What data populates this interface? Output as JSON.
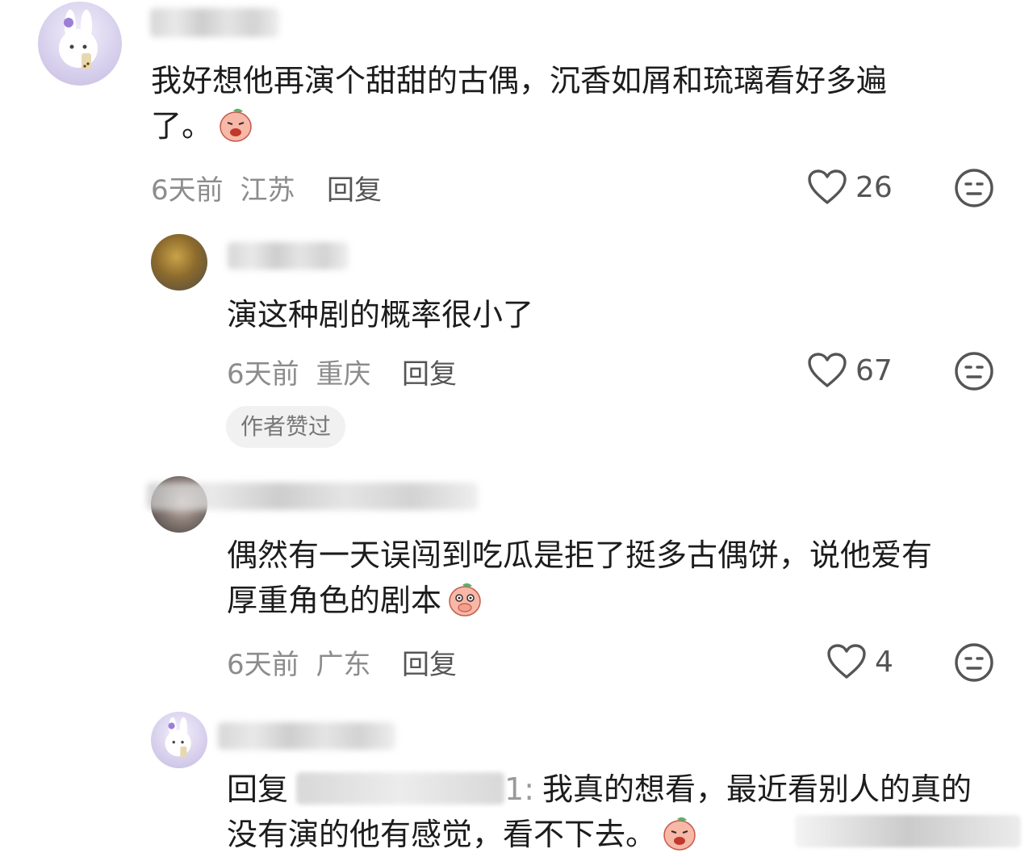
{
  "comments": [
    {
      "text_lines": [
        "我好想他再演个甜甜的古偶，沉香如屑和琉璃看好多遍",
        "了。"
      ],
      "time": "6天前",
      "location": "江苏",
      "reply_label": "回复",
      "likes": "26"
    },
    {
      "text_lines": [
        "演这种剧的概率很小了"
      ],
      "time": "6天前",
      "location": "重庆",
      "reply_label": "回复",
      "likes": "67",
      "badge": "作者赞过"
    },
    {
      "text_lines": [
        "偶然有一天误闯到吃瓜是拒了挺多古偶饼，说他爱有",
        "厚重角色的剧本"
      ],
      "time": "6天前",
      "location": "广东",
      "reply_label": "回复",
      "likes": "4"
    },
    {
      "reply_prefix": "回复",
      "mention_suffix": "1:",
      "text_lines": [
        "我真的想看，最近看别人的真的",
        "没有演的他有感觉，看不下去。"
      ]
    }
  ],
  "icons": {
    "like": "heart-outline-icon",
    "dislike": "neutral-face-icon",
    "emoji": "peach-crying-emoji"
  },
  "colors": {
    "text": "#1c1c1c",
    "meta": "#8c8c8c",
    "badge_bg": "#f1f1f1"
  }
}
